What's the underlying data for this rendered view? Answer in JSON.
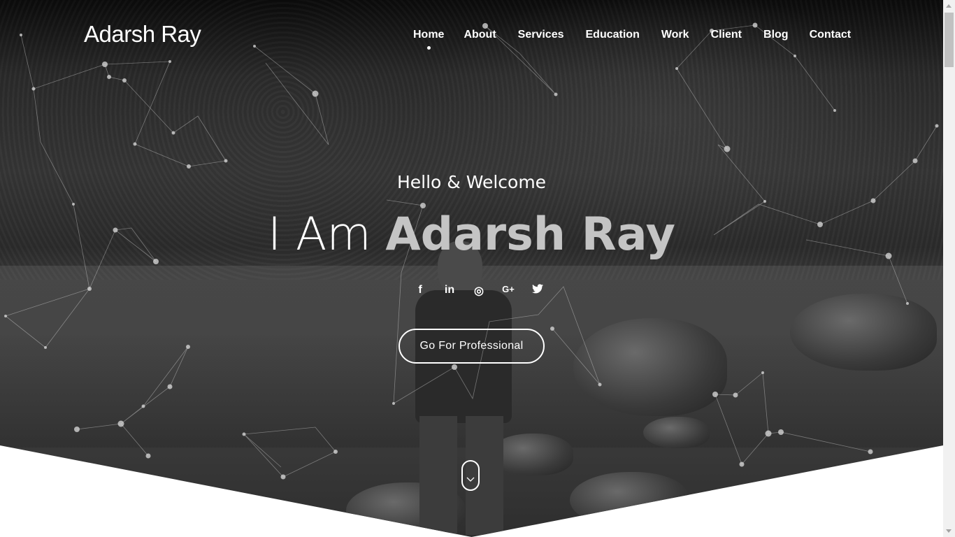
{
  "site": {
    "logo": "Adarsh Ray"
  },
  "nav": {
    "items": [
      {
        "label": "Home",
        "active": true
      },
      {
        "label": "About"
      },
      {
        "label": "Services"
      },
      {
        "label": "Education"
      },
      {
        "label": "Work"
      },
      {
        "label": "Client"
      },
      {
        "label": "Blog"
      },
      {
        "label": "Contact"
      }
    ]
  },
  "hero": {
    "greeting": "Hello & Welcome",
    "headline_prefix": "I Am",
    "headline_name": "Adarsh Ray",
    "cta_label": "Go For Professional",
    "social": [
      {
        "icon": "facebook-icon",
        "glyph": "f"
      },
      {
        "icon": "linkedin-icon",
        "glyph": "in"
      },
      {
        "icon": "dribbble-icon",
        "glyph": "◎"
      },
      {
        "icon": "google-plus-icon",
        "glyph": "G+"
      },
      {
        "icon": "twitter-icon",
        "glyph": "🐦"
      }
    ],
    "scroll_icon": "chevron-down-icon"
  },
  "colors": {
    "text": "#ffffff",
    "name_accent": "#c4c4c4",
    "background": "#ffffff"
  }
}
